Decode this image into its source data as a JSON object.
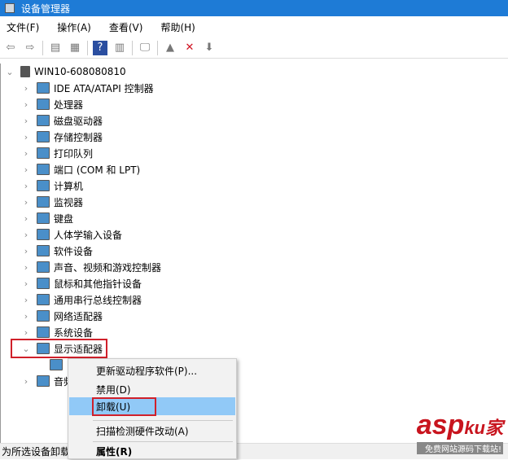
{
  "window": {
    "title": "设备管理器"
  },
  "menubar": [
    "文件(F)",
    "操作(A)",
    "查看(V)",
    "帮助(H)"
  ],
  "toolbar": [
    {
      "icon": "back-arrow-icon",
      "g": "⇦"
    },
    {
      "icon": "forward-arrow-icon",
      "g": "⇨"
    },
    {
      "icon": "show-hide-console-tree-icon",
      "g": "▤"
    },
    {
      "icon": "properties-icon",
      "g": "▦"
    },
    {
      "icon": "help-icon",
      "g": "?"
    },
    {
      "icon": "action-pane-icon",
      "g": "▥"
    },
    {
      "icon": "scan-hardware-icon",
      "g": "🖵"
    },
    {
      "icon": "update-driver-icon",
      "g": "▲"
    },
    {
      "icon": "uninstall-icon",
      "g": "✕"
    },
    {
      "icon": "download-icon",
      "g": "⬇"
    }
  ],
  "tree": {
    "root": "WIN10-608080810",
    "categories": [
      "IDE ATA/ATAPI 控制器",
      "处理器",
      "磁盘驱动器",
      "存储控制器",
      "打印队列",
      "端口 (COM 和 LPT)",
      "计算机",
      "监视器",
      "键盘",
      "人体学输入设备",
      "软件设备",
      "声音、视频和游戏控制器",
      "鼠标和其他指针设备",
      "通用串行总线控制器",
      "网络适配器",
      "系统设备",
      "显示适配器",
      "音频"
    ]
  },
  "context_menu": [
    "更新驱动程序软件(P)...",
    "禁用(D)",
    "卸载(U)",
    "扫描检测硬件改动(A)",
    "属性(R)"
  ],
  "status": "为所选设备卸载",
  "watermark": {
    "brand": "asp",
    "brand2": "ku家",
    "tagline": "免费网站源码下载站!"
  }
}
